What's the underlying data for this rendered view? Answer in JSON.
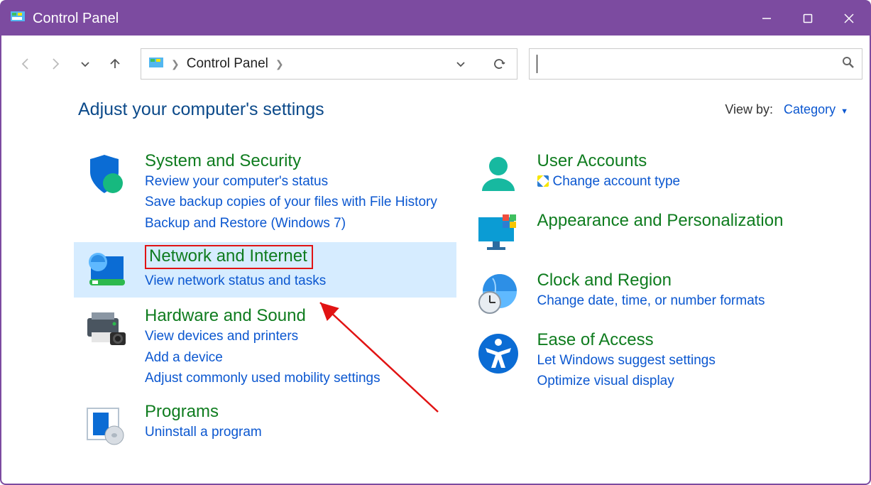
{
  "window": {
    "title": "Control Panel"
  },
  "breadcrumb": {
    "text": "Control Panel"
  },
  "heading": "Adjust your computer's settings",
  "viewby": {
    "label": "View by:",
    "value": "Category"
  },
  "left": [
    {
      "title": "System and Security",
      "links": [
        "Review your computer's status",
        "Save backup copies of your files with File History",
        "Backup and Restore (Windows 7)"
      ]
    },
    {
      "title": "Network and Internet",
      "links": [
        "View network status and tasks"
      ]
    },
    {
      "title": "Hardware and Sound",
      "links": [
        "View devices and printers",
        "Add a device",
        "Adjust commonly used mobility settings"
      ]
    },
    {
      "title": "Programs",
      "links": [
        "Uninstall a program"
      ]
    }
  ],
  "right": [
    {
      "title": "User Accounts",
      "links": [
        "Change account type"
      ],
      "shield": true
    },
    {
      "title": "Appearance and Personalization",
      "links": []
    },
    {
      "title": "Clock and Region",
      "links": [
        "Change date, time, or number formats"
      ]
    },
    {
      "title": "Ease of Access",
      "links": [
        "Let Windows suggest settings",
        "Optimize visual display"
      ]
    }
  ]
}
